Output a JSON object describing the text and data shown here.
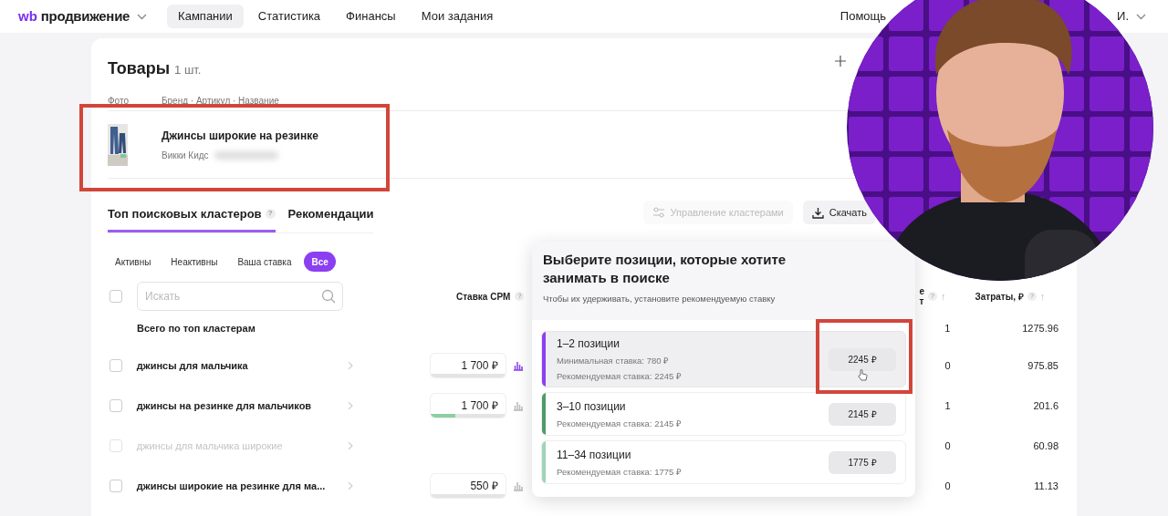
{
  "nav": {
    "logo_mark": "wb",
    "logo_text": "продвижение",
    "tabs": [
      {
        "label": "Кампании",
        "selected": true
      },
      {
        "label": "Статистика",
        "selected": false
      },
      {
        "label": "Финансы",
        "selected": false
      },
      {
        "label": "Мои задания",
        "selected": false
      }
    ],
    "help": "Помощь",
    "user": "И."
  },
  "products": {
    "title": "Товары",
    "count": "1 шт.",
    "columns": [
      "Фото",
      "Бренд · Артикул · Название"
    ],
    "items": [
      {
        "name": "Джинсы широкие на резинке",
        "brand": "Викки Кидс",
        "highlighted": true
      }
    ]
  },
  "cluster_tabs": [
    {
      "label": "Топ поисковых кластеров",
      "help": "?",
      "selected": true
    },
    {
      "label": "Рекомендации",
      "selected": false
    }
  ],
  "actions": [
    {
      "label": "Управление кластерами",
      "disabled": true
    },
    {
      "label": "Скачать",
      "disabled": false
    }
  ],
  "filters": [
    {
      "label": "Активны",
      "selected": false
    },
    {
      "label": "Неактивны",
      "selected": false
    },
    {
      "label": "Ваша ставка",
      "selected": false
    },
    {
      "label": "Все",
      "selected": true
    }
  ],
  "table": {
    "select_all": {
      "checked": false
    },
    "search": {
      "placeholder": "Искать"
    },
    "columns": [
      {
        "label": "Ставка CPM",
        "help": "?"
      },
      {
        "label": "е",
        "label_2": "т",
        "help": "?",
        "sort": "↑"
      },
      {
        "label": "Затраты, ₽",
        "help": "?",
        "sort": "↑"
      }
    ],
    "total": {
      "label": "Всего по топ кластерам",
      "column_3": "1",
      "cost": "1275.96"
    },
    "rows": [
      {
        "name": "джинсы для мальчика",
        "checked": false,
        "disabled": false,
        "bid": "1 700 ₽",
        "selected": true,
        "column_3": "0",
        "cost": "975.85"
      },
      {
        "name": "джинсы на резинке для мальчиков",
        "checked": false,
        "disabled": false,
        "bid": "1 700 ₽",
        "level": 0.33,
        "selected": false,
        "column_3": "1",
        "cost": "201.6"
      },
      {
        "name": "джинсы для мальчика широкие",
        "checked": false,
        "disabled": true,
        "column_3": "0",
        "cost": "60.98"
      },
      {
        "name": "джинсы широкие на резинке для ма...",
        "checked": false,
        "disabled": false,
        "bid": "550 ₽",
        "selected": false,
        "column_3": "0",
        "cost": "11.13"
      }
    ]
  },
  "popup": {
    "title": "Выберите позиции, которые хотите занимать в поиске",
    "subtitle": "Чтобы их удерживать, установите рекомендуемую ставку",
    "options": [
      {
        "label": "1–2 позиции",
        "lines": [
          "Минимальная ставка: 780 ₽",
          "Рекомендуемая ставка: 2245 ₽"
        ],
        "price": "2245 ₽",
        "color": "#8b3ff0",
        "selected": true,
        "highlighted": true
      },
      {
        "label": "3–10 позиции",
        "lines": [
          "Рекомендуемая ставка: 2145 ₽"
        ],
        "price": "2145 ₽",
        "color": "#4f9a6a",
        "selected": false
      },
      {
        "label": "11–34 позиции",
        "lines": [
          "Рекомендуемая ставка: 1775 ₽"
        ],
        "price": "1775 ₽",
        "color": "#9fd5b4",
        "selected": false
      }
    ]
  }
}
